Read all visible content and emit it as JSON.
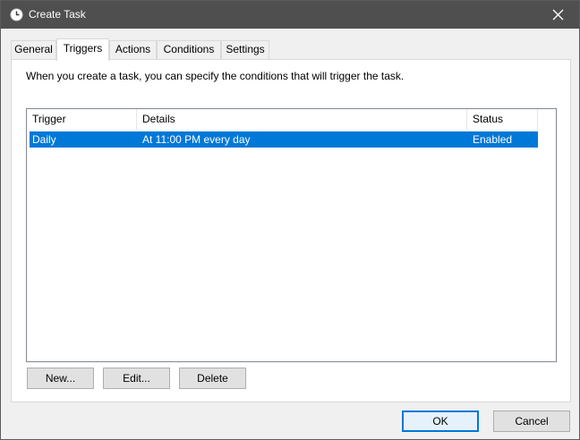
{
  "window": {
    "title": "Create Task",
    "title_icon": "clock-icon",
    "close_icon": "close-icon"
  },
  "tabs": [
    {
      "label": "General"
    },
    {
      "label": "Triggers",
      "active": true
    },
    {
      "label": "Actions"
    },
    {
      "label": "Conditions"
    },
    {
      "label": "Settings"
    }
  ],
  "triggers_panel": {
    "description": "When you create a task, you can specify the conditions that will trigger the task.",
    "columns": [
      "Trigger",
      "Details",
      "Status"
    ],
    "rows": [
      {
        "trigger": "Daily",
        "details": "At 11:00 PM every day",
        "status": "Enabled",
        "selected": true
      }
    ],
    "buttons": {
      "new": "New...",
      "edit": "Edit...",
      "delete": "Delete"
    }
  },
  "footer": {
    "ok": "OK",
    "cancel": "Cancel"
  },
  "colors": {
    "titlebar": "#4f4f4f",
    "selection": "#0078d7",
    "default_button_border": "#0078d7"
  }
}
